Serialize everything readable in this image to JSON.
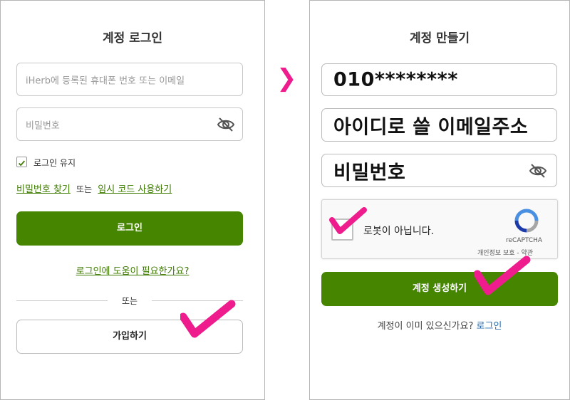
{
  "separator_arrow": "❯",
  "login": {
    "title": "계정 로그인",
    "id_placeholder": "iHerb에 등록된 휴대폰 번호 또는 이메일",
    "password_placeholder": "비밀번호",
    "keep_logged_in": "로그인 유지",
    "find_password": "비밀번호 찾기",
    "or_inline": "또는",
    "temp_code": "임시 코드 사용하기",
    "login_button": "로그인",
    "help_link": "로그인에 도움이 필요한가요?",
    "divider_text": "또는",
    "signup_button": "가입하기"
  },
  "signup": {
    "title": "계정 만들기",
    "phone_value": "010********",
    "email_value": "아이디로 쓸 이메일주소",
    "password_value": "비밀번호",
    "captcha_text": "로봇이 아닙니다.",
    "captcha_brand": "reCAPTCHA",
    "captcha_privacy": "개인정보 보호 - 약관",
    "create_button": "계정 생성하기",
    "existing_prompt": "계정이 이미 있으신가요?",
    "login_link": "로그인"
  },
  "colors": {
    "green": "#458500",
    "pink": "#ee1c8c",
    "link_blue": "#2a6cb0"
  }
}
